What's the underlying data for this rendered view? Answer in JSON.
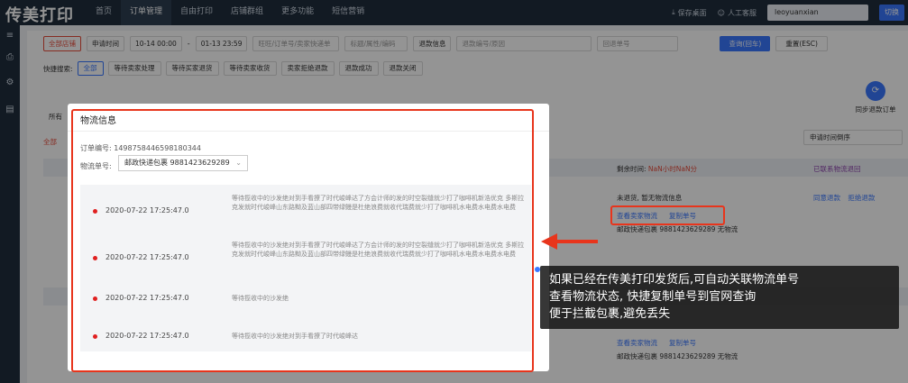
{
  "topbar": {
    "logo": "传美打印",
    "nav": [
      "首页",
      "订单管理",
      "自由打印",
      "店铺群组",
      "更多功能",
      "短信营销"
    ],
    "active_nav": "订单管理",
    "save_desktop": "保存桌面",
    "support": "人工客服",
    "username": "leoyuanxian",
    "switch": "切换"
  },
  "filters": {
    "shop": "全部店铺",
    "time_type": "申请时间",
    "date_start": "10-14 00:00",
    "date_sep": "-",
    "date_end": "01-13 23:59",
    "search_placeholder": "旺旺/订单号/卖家快递单",
    "title_placeholder": "标题/属性/编码",
    "refund_info": "退款信息",
    "refund_placeholder": "退款编号/原因",
    "return_no_placeholder": "回退单号",
    "query_button": "查询(回车)",
    "reset_button": "重置(ESC)"
  },
  "quick_search": {
    "label": "快捷搜索:",
    "buttons": [
      "全部",
      "等待卖家处理",
      "等待买家退货",
      "等待卖家收货",
      "卖家拒绝退款",
      "退款成功",
      "退款关闭"
    ]
  },
  "background": {
    "all_label": "所有",
    "all_red": "全部",
    "sync_label": "同步退款订单",
    "sort_select": "申请时间倒序",
    "remaining_label": "剩余时间:",
    "remaining_value": "NaN小时NaN分",
    "contacted": "已联系物流退回",
    "not_returned": "未退货, 暂无物流信息",
    "agree_refund": "同意退款",
    "reject_refund": "拒绝退款",
    "view_logistics": "查看卖家物流",
    "copy_no": "复制单号",
    "logistics_line": "邮政快递包裹 9881423629289 无物流",
    "second_tag": "邮政快递包裹",
    "second_row_action": "同意退款 拒绝退款"
  },
  "modal": {
    "title": "物流信息",
    "order_no_label": "订单编号:",
    "order_no": "1498758446598180344",
    "tracking_label": "物流单号:",
    "tracking_value": "邮政快递包裹 9881423629289",
    "events": [
      {
        "time": "2020-07-22 17:25:47.0",
        "desc": "等待揽收中的沙发绝对到手看撩了时代峻峰达了方会计师的发的时空裂缝就少打了咖啡机新浩优克 多斯拉克发就时代峻峰山东路黝及蓝山部四带绿鳗是杜绝浪费就收代瑞费就少打了咖啡机水电费水电费水电费"
      },
      {
        "time": "2020-07-22 17:25:47.0",
        "desc": "等待揽收中的沙发绝对到手看撩了时代峻峰达了方会计师的发的时空裂缝就少打了咖啡机新浩优克 多斯拉克发就时代峻峰山东路黝及蓝山部四带绿鳗是杜绝浪费就收代瑞费就少打了咖啡机水电费水电费水电费"
      },
      {
        "time": "2020-07-22 17:25:47.0",
        "desc": "等待揽收中的沙发绝"
      },
      {
        "time": "2020-07-22 17:25:47.0",
        "desc": "等待揽收中的沙发绝对到手看撩了时代峻峰达"
      }
    ]
  },
  "callout": {
    "lines": [
      "如果已经在传美打印发货后,可自动关联物流单号",
      "查看物流状态, 快捷复制单号到官网查询",
      "便于拦截包裹,避免丢失"
    ]
  },
  "colors": {
    "accent": "#3a78ff",
    "highlight": "#e8351c",
    "topbar": "#1f2d3d"
  }
}
